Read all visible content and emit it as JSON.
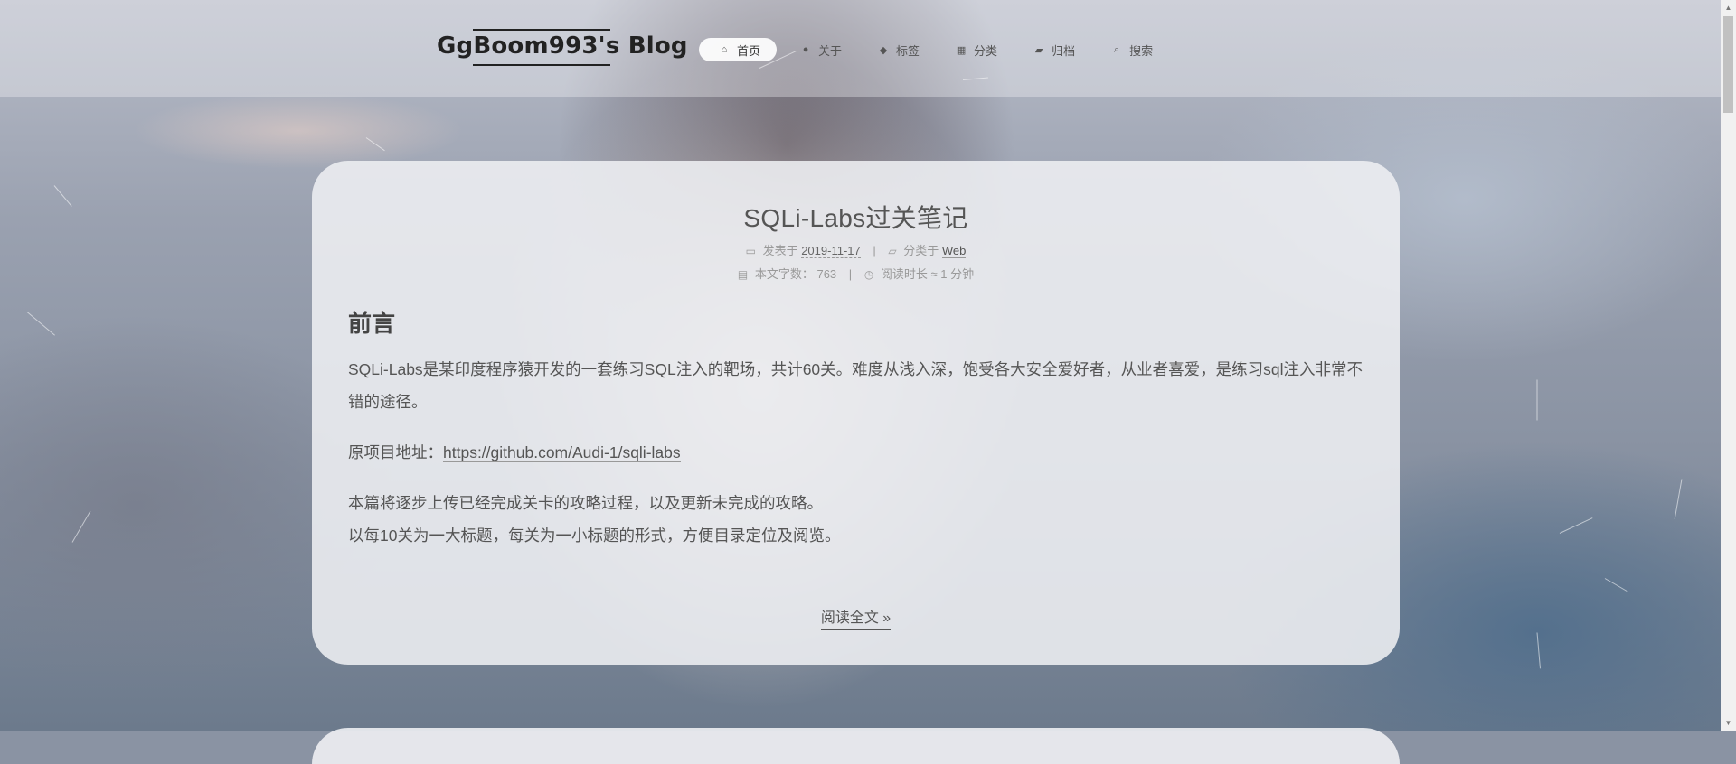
{
  "site": {
    "brand": "GgBoom993's Blog"
  },
  "nav": [
    {
      "icon": "home-icon",
      "glyph": "⌂",
      "label": "首页",
      "active": true
    },
    {
      "icon": "user-icon",
      "glyph": "●",
      "label": "关于",
      "active": false
    },
    {
      "icon": "tags-icon",
      "glyph": "◆",
      "label": "标签",
      "active": false
    },
    {
      "icon": "grid-icon",
      "glyph": "▦",
      "label": "分类",
      "active": false
    },
    {
      "icon": "archive-icon",
      "glyph": "▰",
      "label": "归档",
      "active": false
    },
    {
      "icon": "search-icon",
      "glyph": "⌕",
      "label": "搜索",
      "active": false
    }
  ],
  "post": {
    "title": "SQLi-Labs过关笔记",
    "meta": {
      "posted_label": "发表于",
      "posted_date": "2019-11-17",
      "category_label": "分类于",
      "category": "Web",
      "wordcount_label": "本文字数：",
      "wordcount": "763",
      "readtime_label": "阅读时长 ≈",
      "readtime": "1 分钟",
      "separator": "|"
    },
    "heading": "前言",
    "para1": "SQLi-Labs是某印度程序猿开发的一套练习SQL注入的靶场，共计60关。难度从浅入深，饱受各大安全爱好者，从业者喜爱，是练习sql注入非常不错的途径。",
    "para2_label": "原项目地址：",
    "para2_link": "https://github.com/Audi-1/sqli-labs",
    "para3_line1": "本篇将逐步上传已经完成关卡的攻略过程，以及更新未完成的攻略。",
    "para3_line2": "以每10关为一大标题，每关为一小标题的形式，方便目录定位及阅览。",
    "read_more": "阅读全文 »"
  }
}
